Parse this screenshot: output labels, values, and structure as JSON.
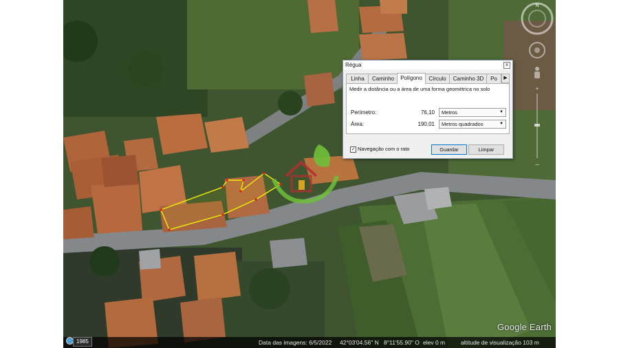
{
  "dialog": {
    "title": "Régua",
    "close_glyph": "x",
    "tabs": [
      {
        "label": "Linha"
      },
      {
        "label": "Caminho"
      },
      {
        "label": "Polígono",
        "active": true
      },
      {
        "label": "Círculo"
      },
      {
        "label": "Caminho 3D"
      },
      {
        "label": "Po"
      }
    ],
    "tab_scroll_glyph": "▶",
    "description": "Medir a distância ou a área de uma forma geométrica no solo",
    "perimeter": {
      "label": "Perímetro:",
      "value": "76,10",
      "unit": "Metros"
    },
    "area": {
      "label": "Área:",
      "value": "190,01",
      "unit": "Metros quadrados"
    },
    "mouse_nav": {
      "label": "Navegação com o rato",
      "checked": true,
      "check_glyph": "✓"
    },
    "buttons": {
      "save": "Guardar",
      "clear": "Limpar"
    }
  },
  "map": {
    "watermark": "Google Earth",
    "status": {
      "year": "1985",
      "imagery_date": "Data das imagens: 6/5/2022",
      "latitude": "42°03'04.56\" N",
      "longitude": "8°11'55.90\" O",
      "elevation": "elev    0 m",
      "eye_altitude": "altitude de visualização   103 m"
    },
    "icons": [
      "compass-icon",
      "look-joystick-icon",
      "street-view-pegman-icon",
      "zoom-slider-icon",
      "logo-house-icon"
    ],
    "colors": {
      "polygon_edge": "#f2f200",
      "polygon_vertex": "#e02020",
      "logo_green": "#6fbf3a",
      "logo_red": "#b03030"
    }
  }
}
